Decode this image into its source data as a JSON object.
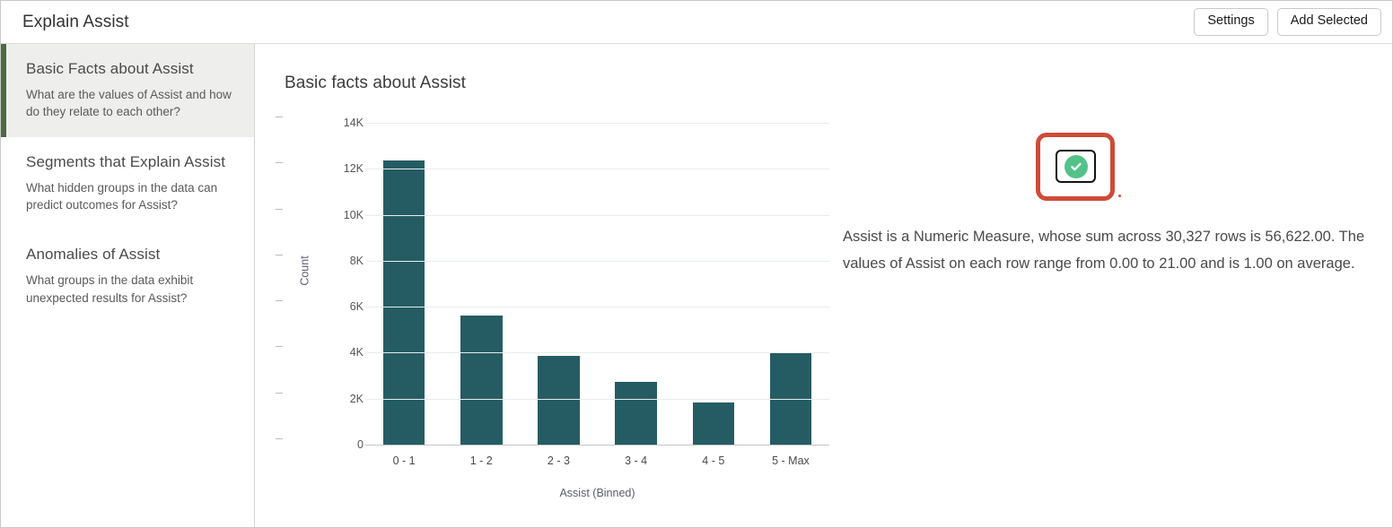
{
  "header": {
    "title": "Explain Assist",
    "settings_label": "Settings",
    "add_selected_label": "Add Selected"
  },
  "sidebar": {
    "items": [
      {
        "title": "Basic Facts about Assist",
        "desc": "What are the values of Assist and how do they relate to each other?",
        "active": true
      },
      {
        "title": "Segments that Explain Assist",
        "desc": "What hidden groups in the data can predict outcomes for Assist?",
        "active": false
      },
      {
        "title": "Anomalies of Assist",
        "desc": "What groups in the data exhibit unexpected results for Assist?",
        "active": false
      }
    ]
  },
  "main": {
    "panel_title": "Basic facts about Assist",
    "narrative": "Assist is a Numeric Measure, whose sum across 30,327 rows is 56,622.00. The values of Assist on each row range from 0.00 to 21.00 and is 1.00 on average.",
    "status_badge": {
      "icon": "check-circle-icon",
      "color": "#53c289",
      "highlight_color": "#cf4b38"
    }
  },
  "chart_data": {
    "type": "bar",
    "title": "Basic facts about Assist",
    "categories": [
      "0 - 1",
      "1 - 2",
      "2 - 3",
      "3 - 4",
      "4 - 5",
      "5 - Max"
    ],
    "values": [
      12350,
      5600,
      3880,
      2720,
      1840,
      3960
    ],
    "xlabel": "Assist (Binned)",
    "ylabel": "Count",
    "ylim": [
      0,
      14000
    ],
    "yticks": [
      0,
      2000,
      4000,
      6000,
      8000,
      10000,
      12000,
      14000
    ],
    "ytick_labels": [
      "0",
      "2K",
      "4K",
      "6K",
      "8K",
      "10K",
      "12K",
      "14K"
    ],
    "grid": true,
    "legend": false,
    "series_color": "#255C63"
  }
}
